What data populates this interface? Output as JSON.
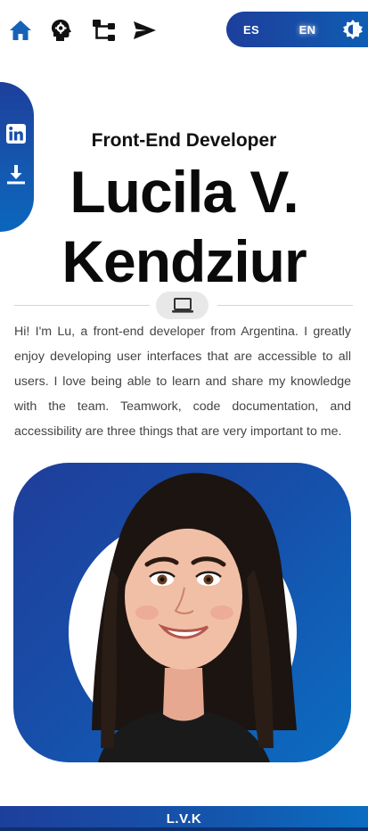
{
  "nav": {
    "items": [
      {
        "name": "home",
        "icon": "home-icon",
        "color": "#1762b8"
      },
      {
        "name": "skills",
        "icon": "head-gear-icon",
        "color": "#111111"
      },
      {
        "name": "projects",
        "icon": "flowchart-icon",
        "color": "#111111"
      },
      {
        "name": "contact",
        "icon": "send-icon",
        "color": "#111111"
      }
    ]
  },
  "language": {
    "options": [
      "ES",
      "EN"
    ],
    "selected": "EN",
    "theme_toggle_icon": "brightness-icon"
  },
  "social": {
    "items": [
      {
        "name": "linkedin",
        "icon": "linkedin-icon"
      },
      {
        "name": "download-cv",
        "icon": "download-icon"
      }
    ]
  },
  "hero": {
    "subtitle": "Front-End Developer",
    "name_line1": "Lucila V.",
    "name_line2": "Kendziur",
    "divider_icon": "laptop-icon",
    "bio": "Hi! I'm Lu, a front-end developer from Argentina. I greatly enjoy developing user interfaces that are accessible to all users. I love being able to learn and share my knowledge with the team. Teamwork, code documentation, and accessibility are three things that are very important to me."
  },
  "portrait": {
    "description_icon": "avatar-illustration"
  },
  "footer": {
    "text": "L.V.K"
  },
  "colors": {
    "accent_blue": "#1650ab",
    "accent_blue_light": "#0b6dc1",
    "text_dark": "#0a0a0a",
    "bio_text": "#444444"
  }
}
